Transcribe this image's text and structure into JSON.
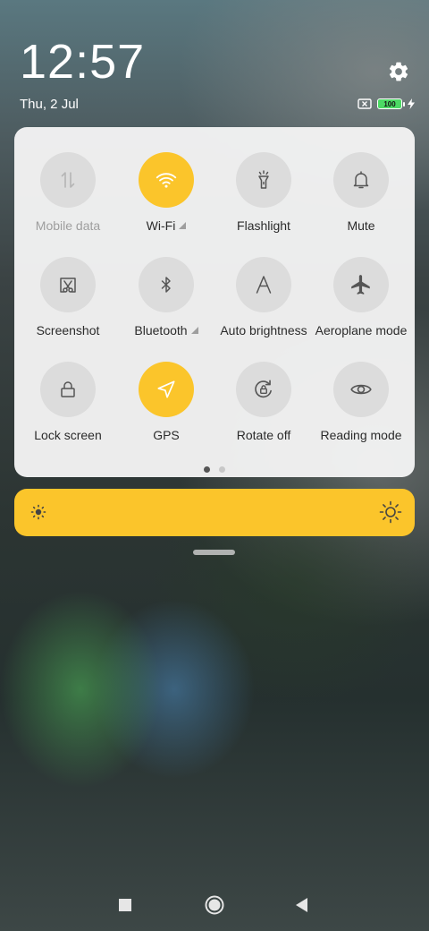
{
  "status": {
    "time": "12:57",
    "date": "Thu, 2 Jul",
    "battery_level": "100",
    "charging": true
  },
  "quick_settings": {
    "tiles": [
      {
        "label": "Mobile data",
        "state": "unavailable",
        "icon": "mobile-data-icon"
      },
      {
        "label": "Wi-Fi",
        "state": "on",
        "icon": "wifi-icon",
        "expandable": true
      },
      {
        "label": "Flashlight",
        "state": "off",
        "icon": "flashlight-icon"
      },
      {
        "label": "Mute",
        "state": "off",
        "icon": "bell-icon"
      },
      {
        "label": "Screenshot",
        "state": "off",
        "icon": "screenshot-icon"
      },
      {
        "label": "Bluetooth",
        "state": "off",
        "icon": "bluetooth-icon",
        "expandable": true
      },
      {
        "label": "Auto brightness",
        "state": "off",
        "icon": "auto-brightness-icon"
      },
      {
        "label": "Aeroplane mode",
        "state": "off",
        "icon": "airplane-icon"
      },
      {
        "label": "Lock screen",
        "state": "off",
        "icon": "lock-icon"
      },
      {
        "label": "GPS",
        "state": "on",
        "icon": "location-arrow-icon"
      },
      {
        "label": "Rotate off",
        "state": "off",
        "icon": "rotation-lock-icon"
      },
      {
        "label": "Reading mode",
        "state": "off",
        "icon": "eye-icon"
      }
    ],
    "page_count": 2,
    "current_page": 1
  },
  "brightness": {
    "level": 1.0
  },
  "colors": {
    "accent": "#fbc52b",
    "tile_off": "#dcdcdc",
    "panel_bg": "#f4f4f4"
  },
  "navbar": {
    "buttons": [
      "recents",
      "home",
      "back"
    ]
  }
}
